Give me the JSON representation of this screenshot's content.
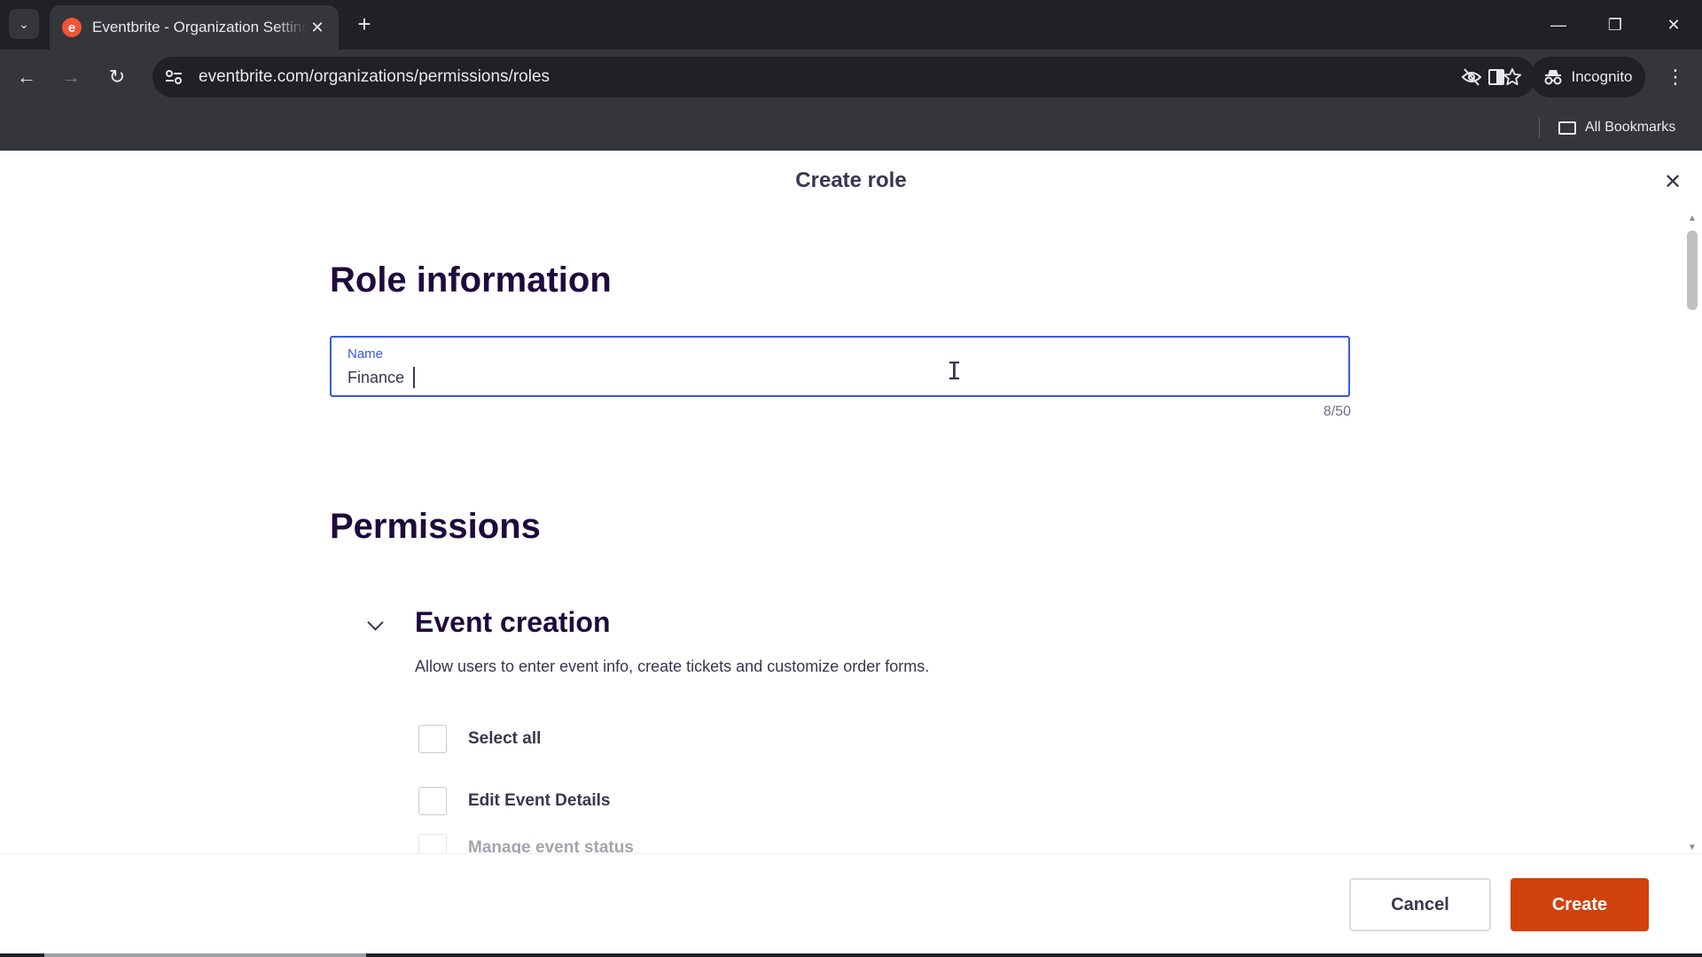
{
  "browser": {
    "tab": {
      "title": "Eventbrite - Organization Settings",
      "favicon_letter": "e",
      "close_glyph": "✕"
    },
    "new_tab_glyph": "+",
    "tab_search_glyph": "⌄",
    "window_controls": {
      "minimize": "—",
      "restore": "❐",
      "close": "✕"
    },
    "nav": {
      "back": "←",
      "forward": "→",
      "reload": "↻"
    },
    "url": "eventbrite.com/organizations/permissions/roles",
    "incognito_label": "Incognito",
    "menu_glyph": "⋮",
    "bookmarks_label": "All Bookmarks",
    "colors": {
      "chrome_dark": "#202124",
      "chrome_mid": "#35363a"
    }
  },
  "modal": {
    "title": "Create role",
    "close_glyph": "✕"
  },
  "role_info": {
    "heading": "Role information",
    "name_label": "Name",
    "name_value": "Finance",
    "counter": "8/50"
  },
  "permissions": {
    "heading": "Permissions",
    "groups": [
      {
        "title": "Event creation",
        "description": "Allow users to enter event info, create tickets and customize order forms.",
        "items": [
          {
            "label": "Select all",
            "checked": false
          },
          {
            "label": "Edit Event Details",
            "checked": false
          },
          {
            "label": "Manage event status",
            "checked": false
          }
        ]
      }
    ]
  },
  "footer": {
    "cancel_label": "Cancel",
    "create_label": "Create"
  },
  "colors": {
    "accent_blue": "#3659e3",
    "create_orange": "#d1410c",
    "heading_dark": "#1e0a3c",
    "text": "#39364f"
  }
}
